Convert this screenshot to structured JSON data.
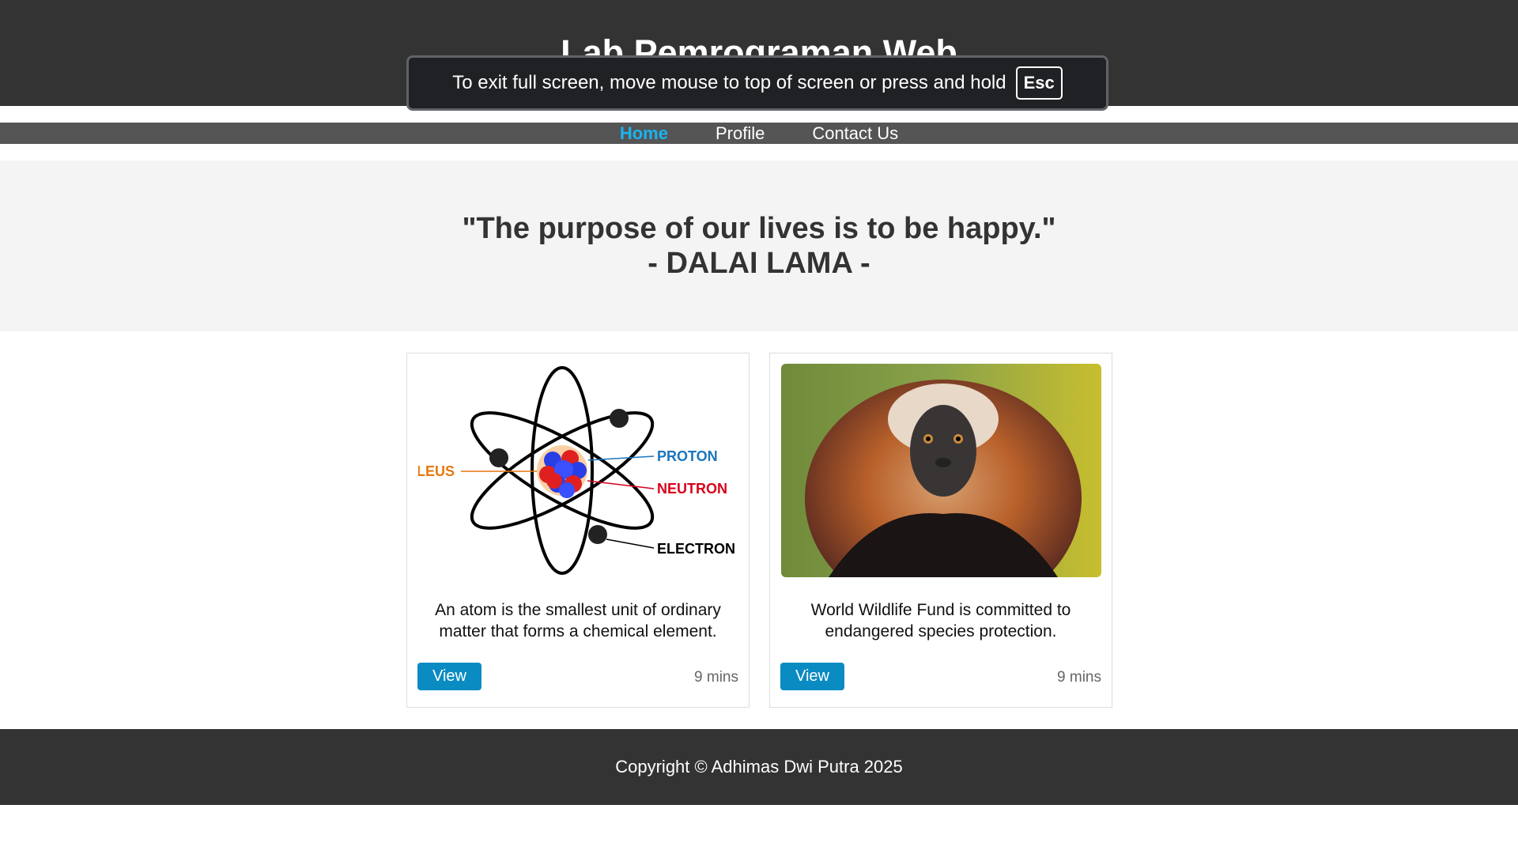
{
  "header": {
    "title": "Lab Pemrograman Web"
  },
  "fullscreen_notice": {
    "message": "To exit full screen, move mouse to top of screen or press and hold",
    "key": "Esc"
  },
  "nav": {
    "items": [
      {
        "label": "Home",
        "active": true
      },
      {
        "label": "Profile",
        "active": false
      },
      {
        "label": "Contact Us",
        "active": false
      }
    ]
  },
  "hero": {
    "quote": "\"The purpose of our lives is to be happy.\"",
    "author": "- DALAI LAMA -"
  },
  "cards": [
    {
      "image_labels": {
        "nucleus": "LEUS",
        "proton": "PROTON",
        "neutron": "NEUTRON",
        "electron": "ELECTRON"
      },
      "description": "An atom is the smallest unit of ordinary matter that forms a chemical element.",
      "button": "View",
      "time": "9 mins"
    },
    {
      "description": "World Wildlife Fund is committed to endangered species protection.",
      "button": "View",
      "time": "9 mins"
    }
  ],
  "footer": {
    "copyright": "Copyright © Adhimas Dwi Putra 2025"
  },
  "colors": {
    "header_bg": "#333333",
    "nav_bg": "#555555",
    "nav_active": "#1ab4f0",
    "button_bg": "#0a8bc2",
    "hero_bg": "#f4f4f4"
  }
}
